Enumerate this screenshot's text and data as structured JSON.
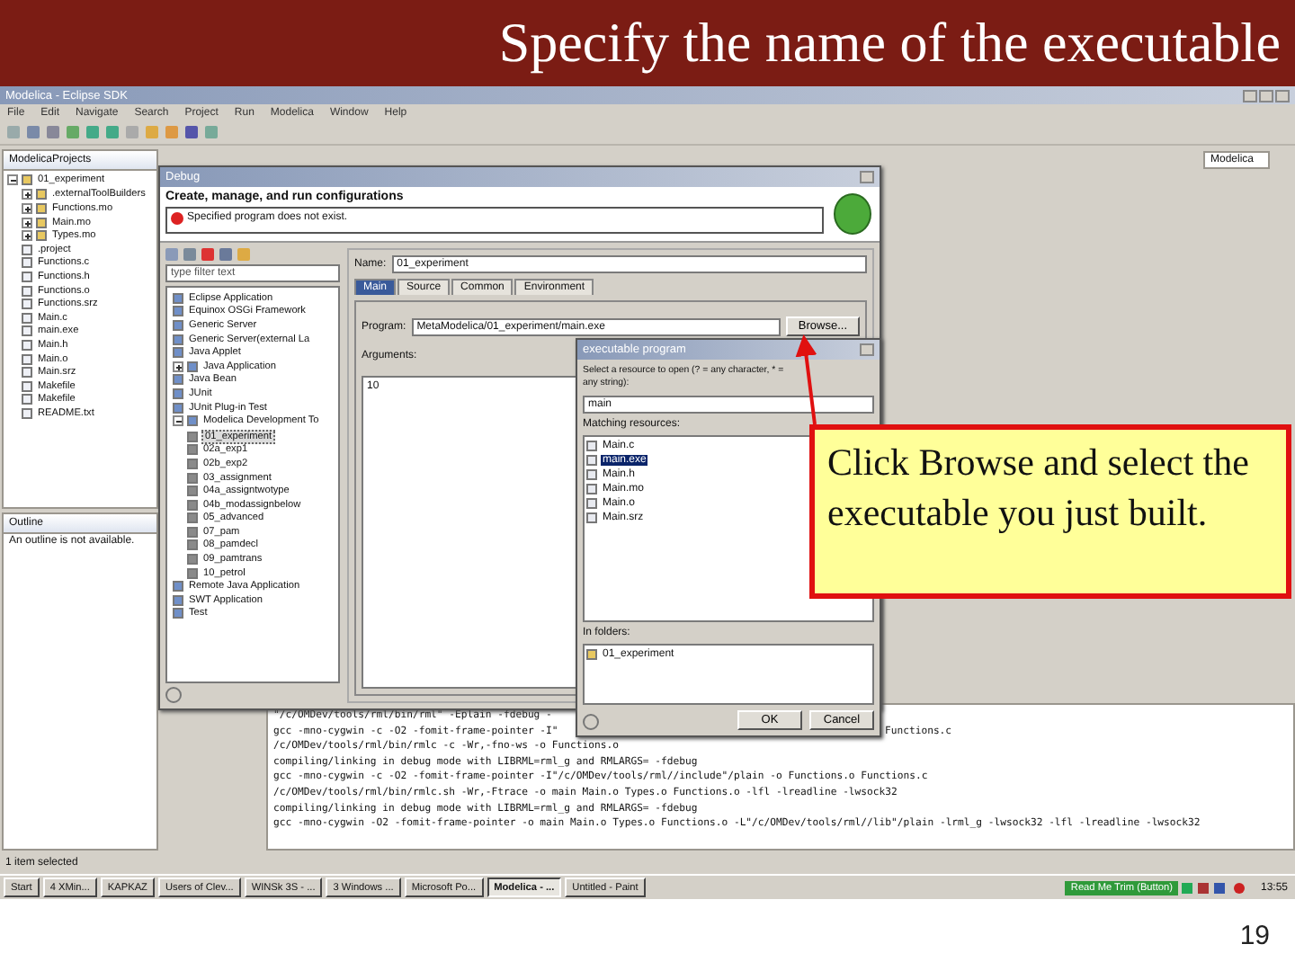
{
  "slide": {
    "title": "Specify the name of the executable",
    "page_number": "19"
  },
  "eclipse": {
    "title": "Modelica - Eclipse SDK",
    "menu": [
      "File",
      "Edit",
      "Navigate",
      "Search",
      "Project",
      "Run",
      "Modelica",
      "Window",
      "Help"
    ],
    "perspective": "Modelica",
    "navigator": {
      "tab": "ModelicaProjects",
      "tree": [
        {
          "label": "01_experiment",
          "expanded": true,
          "children": [
            {
              "label": ".externalToolBuilders",
              "expanded": false
            },
            {
              "label": "Functions.mo",
              "expanded": false
            },
            {
              "label": "Main.mo",
              "expanded": false
            },
            {
              "label": "Types.mo",
              "expanded": false
            },
            {
              "label": ".project"
            },
            {
              "label": "Functions.c"
            },
            {
              "label": "Functions.h"
            },
            {
              "label": "Functions.o"
            },
            {
              "label": "Functions.srz"
            },
            {
              "label": "Main.c"
            },
            {
              "label": "main.exe"
            },
            {
              "label": "Main.h"
            },
            {
              "label": "Main.o"
            },
            {
              "label": "Main.srz"
            },
            {
              "label": "Makefile"
            },
            {
              "label": "Makefile"
            },
            {
              "label": "README.txt"
            }
          ]
        }
      ]
    },
    "outline": {
      "tab": "Outline",
      "message": "An outline is not available."
    },
    "console": {
      "lines": [
        {
          "text": "\"/c/OMDev/tools/rml/bin/rml\" -Eplain -fdebug -"
        },
        {
          "text": "gcc -mno-cygwin -c -O2 -fomit-frame-pointer -I\"",
          "tail": "Functions.c"
        },
        {
          "text": "/c/OMDev/tools/rml/bin/rmlc -c -Wr,-fno-ws -o Functions.o"
        },
        {
          "text": "compiling/linking in debug mode with LIBRML=rml_g and RMLARGS= -fdebug"
        },
        {
          "text": "gcc -mno-cygwin -c -O2 -fomit-frame-pointer -I\"/c/OMDev/tools/rml//include\"/plain -o Functions.o Functions.c"
        },
        {
          "text": "/c/OMDev/tools/rml/bin/rmlc.sh -Wr,-Ftrace -o main Main.o Types.o Functions.o -lfl -lreadline -lwsock32"
        },
        {
          "text": "compiling/linking in debug mode with LIBRML=rml_g and RMLARGS= -fdebug"
        },
        {
          "text": "gcc -mno-cygwin -O2 -fomit-frame-pointer -o main Main.o Types.o Functions.o -L\"/c/OMDev/tools/rml//lib\"/plain -lrml_g -lwsock32 -lfl -lreadline -lwsock32"
        }
      ]
    },
    "status": "1 item selected",
    "taskbar": {
      "start": "Start",
      "items": [
        {
          "label": "4 XMin...",
          "selected": false
        },
        {
          "label": "KAPKAZ",
          "selected": false
        },
        {
          "label": "Users of Clev...",
          "selected": false
        },
        {
          "label": "WINSk 3S - ...",
          "selected": false
        },
        {
          "label": "3 Windows ...",
          "selected": false
        },
        {
          "label": "Microsoft Po...",
          "selected": false
        },
        {
          "label": "Modelica - ...",
          "selected": true
        },
        {
          "label": "Untitled - Paint",
          "selected": false
        }
      ],
      "trim_button": "Read Me Trim (Button)",
      "clock": "13:55"
    }
  },
  "debug_dialog": {
    "title": "Debug",
    "heading": "Create, manage, and run configurations",
    "error": "Specified program does not exist.",
    "filter_placeholder": "type filter text",
    "tree": [
      {
        "label": "Eclipse Application"
      },
      {
        "label": "Equinox OSGi Framework"
      },
      {
        "label": "Generic Server"
      },
      {
        "label": "Generic Server(external La"
      },
      {
        "label": "Java Applet"
      },
      {
        "label": "Java Application",
        "expanded": false
      },
      {
        "label": "Java Bean"
      },
      {
        "label": "JUnit"
      },
      {
        "label": "JUnit Plug-in Test"
      },
      {
        "label": "Modelica Development To",
        "expanded": true,
        "children": [
          {
            "label": "01_experiment",
            "selected": true
          },
          {
            "label": "02a_exp1",
            "selected": false
          },
          {
            "label": "02b_exp2",
            "selected": false
          },
          {
            "label": "03_assignment",
            "selected": false
          },
          {
            "label": "04a_assigntwotype",
            "selected": false
          },
          {
            "label": "04b_modassignbelow",
            "selected": false
          },
          {
            "label": "05_advanced",
            "selected": false
          },
          {
            "label": "07_pam",
            "selected": false
          },
          {
            "label": "08_pamdecl",
            "selected": false
          },
          {
            "label": "09_pamtrans",
            "selected": false
          },
          {
            "label": "10_petrol",
            "selected": false
          }
        ]
      },
      {
        "label": "Remote Java Application"
      },
      {
        "label": "SWT Application"
      },
      {
        "label": "Test"
      }
    ],
    "name_label": "Name:",
    "name_value": "01_experiment",
    "tabs": [
      {
        "label": "Main",
        "selected": true
      },
      {
        "label": "Source",
        "selected": false
      },
      {
        "label": "Common",
        "selected": false
      },
      {
        "label": "Environment",
        "selected": false
      }
    ],
    "program_label": "Program:",
    "program_value": "MetaModelica/01_experiment/main.exe",
    "browse": "Browse...",
    "arguments_label": "Arguments:",
    "arguments_value": "10"
  },
  "executable_dialog": {
    "title": "executable program",
    "prompt": "Select a resource to open (? = any character, * = any string):",
    "pattern": "main",
    "matching_label": "Matching resources:",
    "resources": [
      {
        "label": "Main.c",
        "selected": false
      },
      {
        "label": "main.exe",
        "selected": true
      },
      {
        "label": "Main.h",
        "selected": false
      },
      {
        "label": "Main.mo",
        "selected": false
      },
      {
        "label": "Main.o",
        "selected": false
      },
      {
        "label": "Main.srz",
        "selected": false
      }
    ],
    "folders_label": "In folders:",
    "folders": [
      "01_experiment"
    ],
    "buttons": [
      "OK",
      "Cancel"
    ]
  },
  "callout": {
    "text": "Click Browse and select the executable you just built."
  }
}
